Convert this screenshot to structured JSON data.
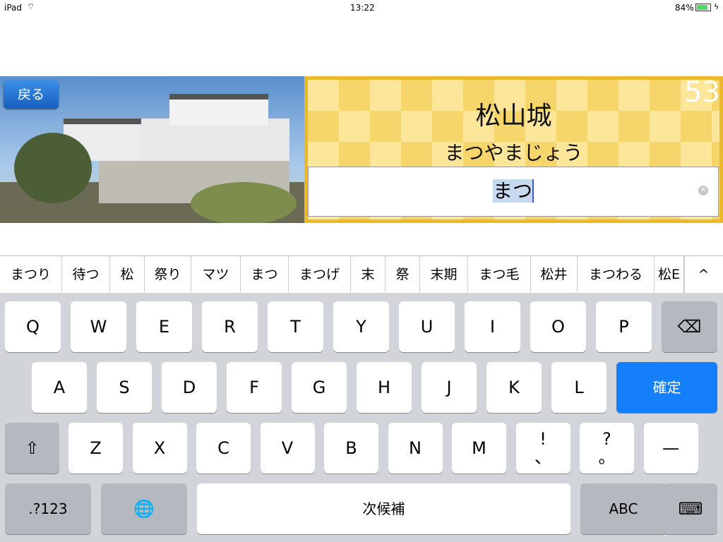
{
  "status": {
    "device": "iPad",
    "time": "13:22",
    "battery": "84%"
  },
  "back_label": "戻る",
  "card": {
    "title": "松山城",
    "reading": "まつやまじょう",
    "count": "53",
    "input_value": "まつ"
  },
  "candidates": [
    "まつり",
    "待つ",
    "松",
    "祭り",
    "マツ",
    "まつ",
    "まつげ",
    "末",
    "祭",
    "末期",
    "まつ毛",
    "松井",
    "まつわる",
    "松E"
  ],
  "keyboard": {
    "row1": [
      "Q",
      "W",
      "E",
      "R",
      "T",
      "Y",
      "U",
      "I",
      "O",
      "P"
    ],
    "row2": [
      "A",
      "S",
      "D",
      "F",
      "G",
      "H",
      "J",
      "K",
      "L"
    ],
    "row3": [
      "Z",
      "X",
      "C",
      "V",
      "B",
      "N",
      "M",
      "!\n、",
      "?\n。",
      "—"
    ],
    "confirm": "確定",
    "numbers": ".?123",
    "space": "次候補",
    "abc": "ABC"
  },
  "colors": {
    "accent": "#147efb",
    "gold": "#eab829"
  }
}
